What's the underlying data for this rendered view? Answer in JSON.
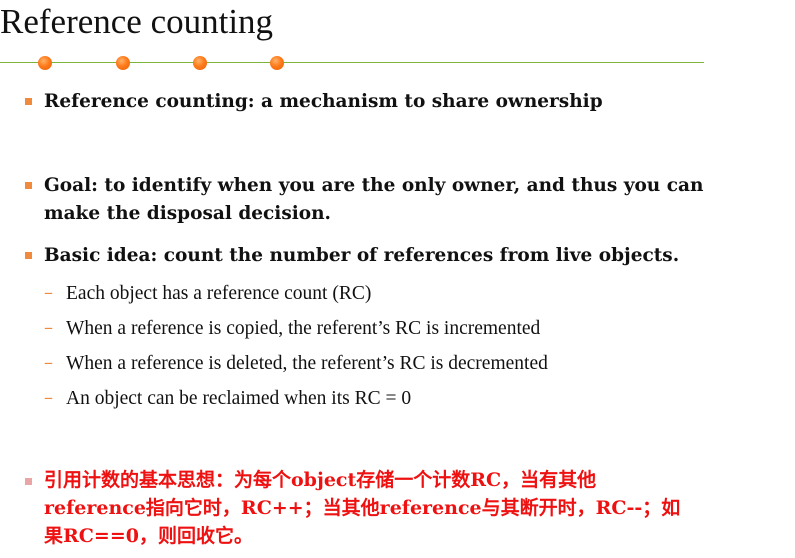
{
  "title": "Reference counting",
  "bullets": [
    {
      "lines": [
        "Reference counting: a mechanism to share ownership"
      ]
    },
    {
      "lines": [
        "Goal: to identify when you are the only owner, and thus you can",
        "make the disposal decision."
      ]
    },
    {
      "lines": [
        "Basic idea: count the number of references from live objects."
      ],
      "sub_items": [
        "Each object has a reference count (RC)",
        "When a reference is copied, the referent’s RC is incremented",
        "When a reference is deleted, the referent’s RC is decremented",
        "An object can be reclaimed when its RC = 0"
      ],
      "dash": "–"
    }
  ],
  "note": {
    "lines": [
      "引用计数的基本思想：为每个object存储一个计数RC，当有其他",
      "reference指向它时，RC++；当其他reference与其断开时，RC--；如",
      "果RC==0，则回收它。"
    ]
  },
  "colors": {
    "bullet": "#f08a3c",
    "dot": "#ff7a1a",
    "rule": "#7db43a",
    "note_text": "#ee1111"
  }
}
